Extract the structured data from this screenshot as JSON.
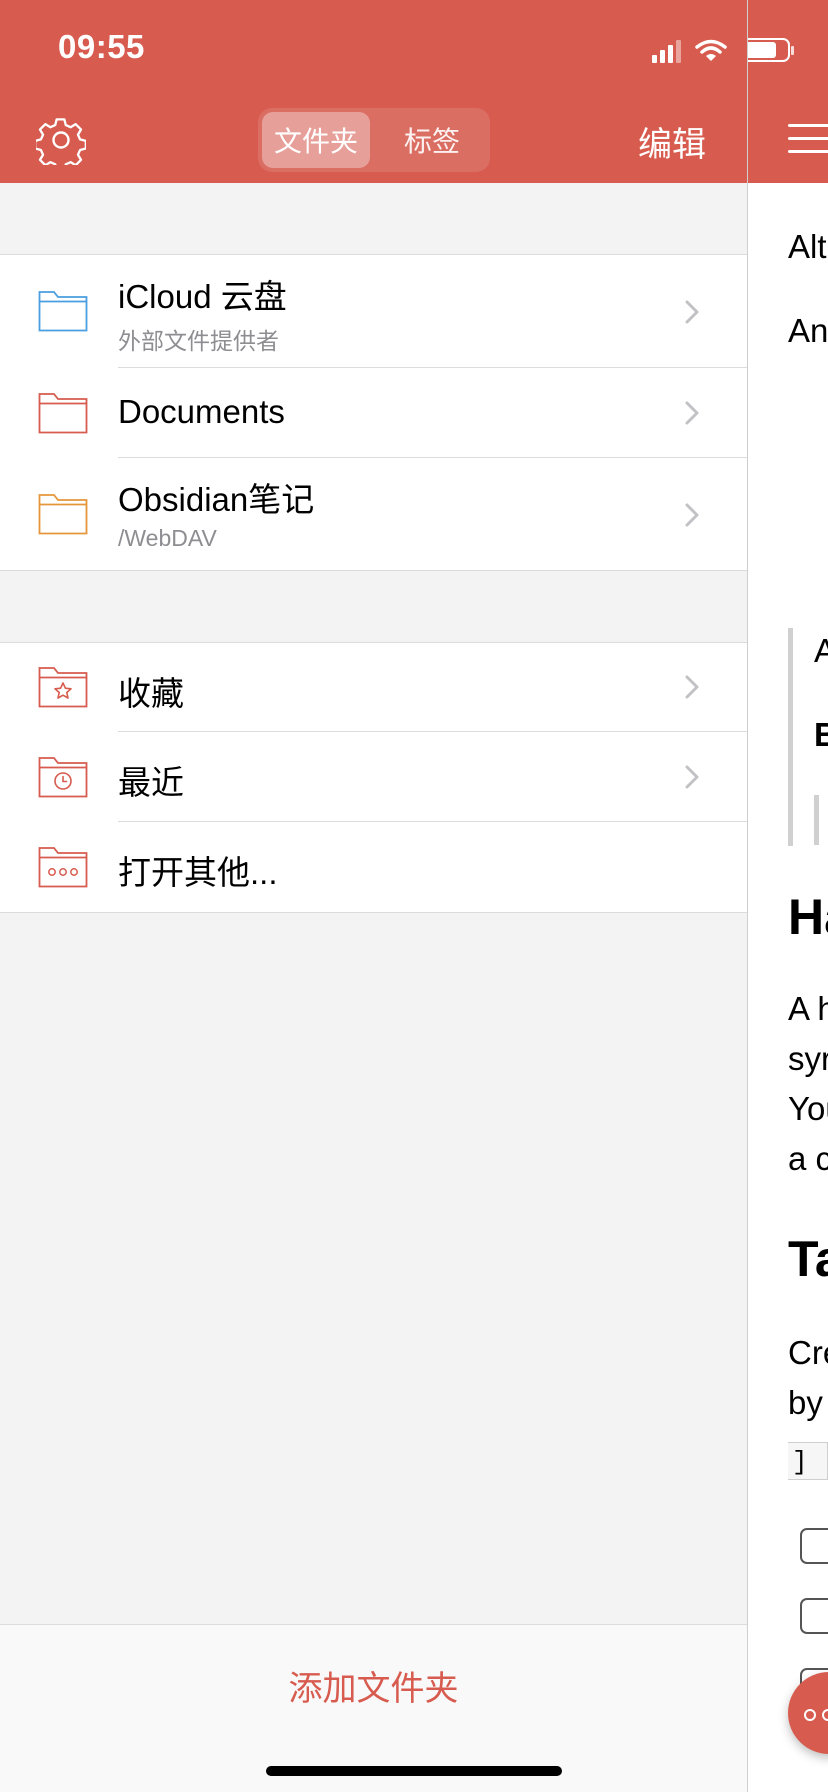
{
  "status_bar": {
    "time": "09:55"
  },
  "header": {
    "settings_icon": "gear-icon",
    "segments": [
      "文件夹",
      "标签"
    ],
    "active_segment": "文件夹",
    "edit_label": "编辑",
    "menu_icon": "hamburger-menu-icon"
  },
  "locations": [
    {
      "title": "iCloud 云盘",
      "subtitle": "外部文件提供者",
      "icon": "folder-icon",
      "color": "#4a9fe0"
    },
    {
      "title": "Documents",
      "subtitle": "",
      "icon": "folder-icon",
      "color": "#d75b4e"
    },
    {
      "title": "Obsidian笔记",
      "subtitle": "/WebDAV",
      "icon": "folder-icon",
      "color": "#e5963b"
    }
  ],
  "shortcuts": [
    {
      "title": "收藏",
      "icon": "star-folder-icon"
    },
    {
      "title": "最近",
      "icon": "clock-folder-icon"
    },
    {
      "title": "打开其他...",
      "icon": "more-folder-icon"
    }
  ],
  "footer": {
    "add_folder_label": "添加文件夹"
  },
  "editor_visible": {
    "line1": "Alt",
    "line2": "An",
    "quote1": "A",
    "quote2": "B",
    "heading1": "Ha",
    "para1": [
      "A h",
      "syr",
      "You",
      "a c"
    ],
    "heading2": "Ta",
    "para2": [
      "Cre",
      "by"
    ],
    "code": "]"
  },
  "colors": {
    "accent": "#d75b4e",
    "background": "#f3f3f3"
  }
}
